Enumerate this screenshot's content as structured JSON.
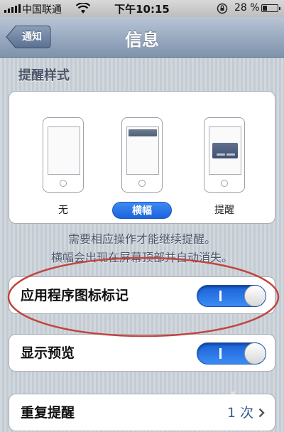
{
  "status_bar": {
    "carrier": "中国联通",
    "time": "下午10:15",
    "battery": "28 %",
    "battery_level": 0.28
  },
  "nav": {
    "back_label": "通知",
    "title": "信息"
  },
  "alert_style": {
    "header": "提醒样式",
    "options": [
      {
        "label": "无",
        "selected": false
      },
      {
        "label": "横幅",
        "selected": true
      },
      {
        "label": "提醒",
        "selected": false
      }
    ],
    "footnote_line1": "需要相应操作才能继续提醒。",
    "footnote_line2": "横幅会出现在屏幕顶部并自动消失。"
  },
  "settings": {
    "badge_app_icon": {
      "label": "应用程序图标标记",
      "on": true
    },
    "show_preview": {
      "label": "显示预览",
      "on": true
    },
    "repeat_alert": {
      "label": "重复提醒",
      "value": "1 次"
    }
  },
  "watermark": "nd.cn",
  "colors": {
    "accent_blue": "#2a74e8",
    "annotation_red": "#c0453f",
    "nav_bar": "#9aabc1",
    "background": "#cbd2d9"
  },
  "icons": [
    "signal-icon",
    "wifi-icon",
    "rotation-lock-icon",
    "battery-icon",
    "chevron-right-icon",
    "back-arrow"
  ]
}
